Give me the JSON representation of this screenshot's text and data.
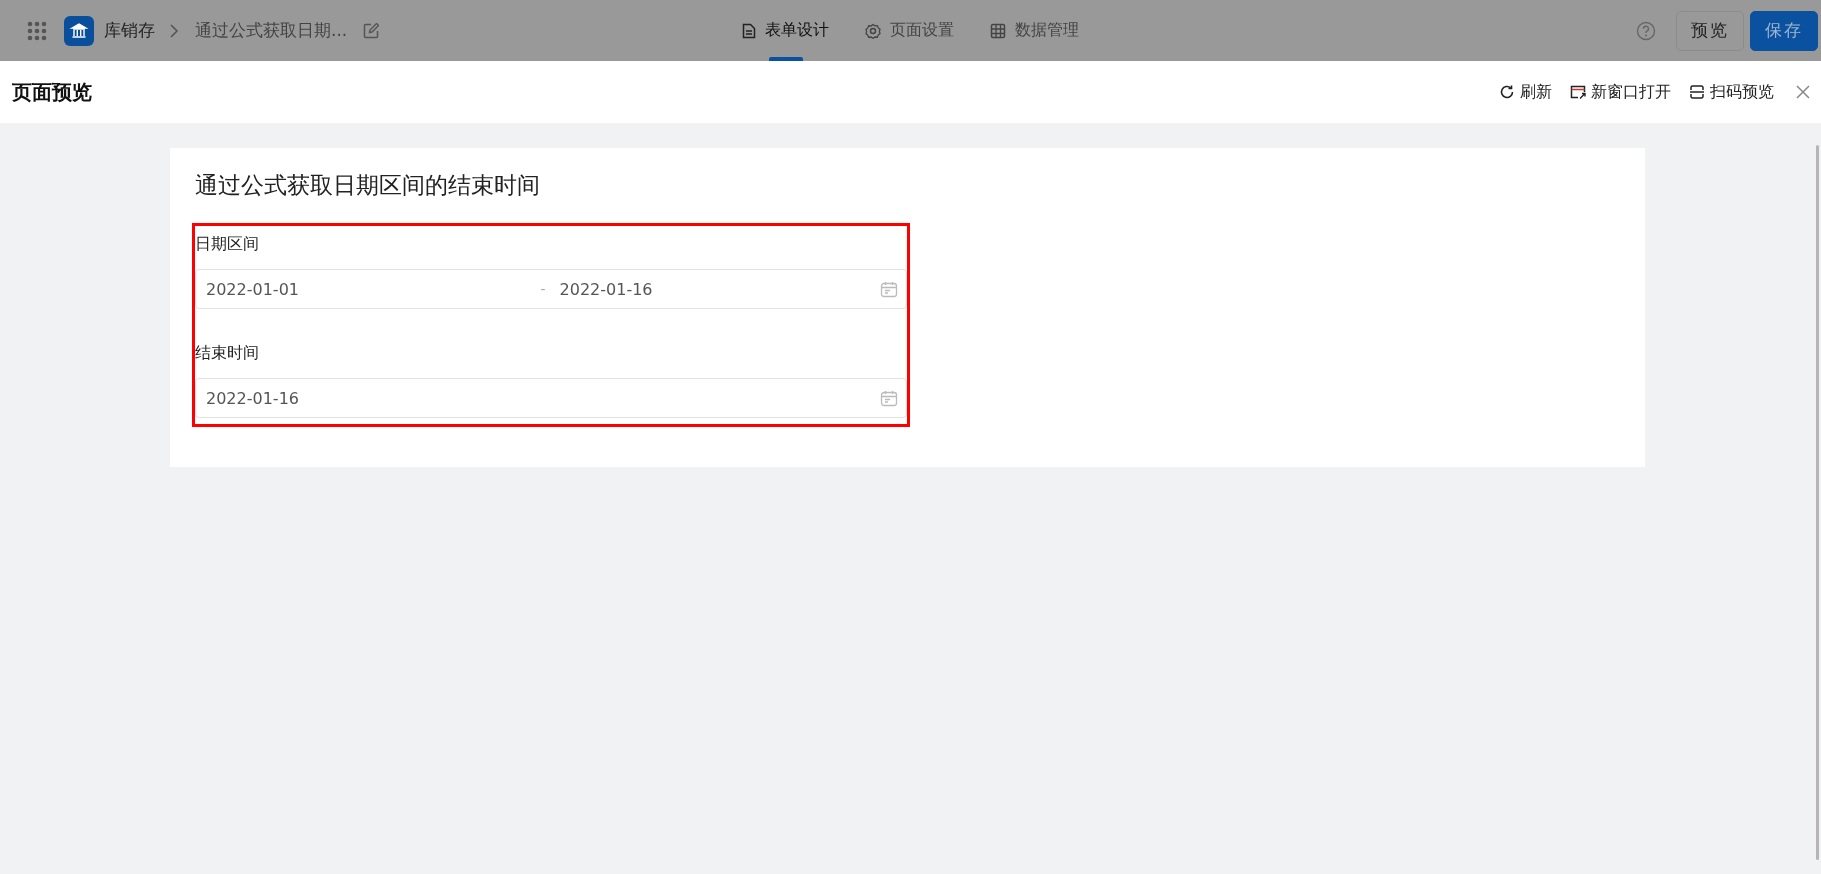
{
  "top_bar": {
    "app_name": "库销存",
    "page_title": "通过公式获取日期...",
    "tabs": [
      {
        "label": "表单设计",
        "selected": true
      },
      {
        "label": "页面设置",
        "selected": false
      },
      {
        "label": "数据管理",
        "selected": false
      }
    ],
    "buttons": [
      {
        "label": "预览",
        "kind": "default"
      },
      {
        "label": "保存",
        "kind": "primary"
      }
    ]
  },
  "preview": {
    "title": "页面预览",
    "actions": [
      {
        "label": "刷新"
      },
      {
        "label": "新窗口打开"
      },
      {
        "label": "扫码预览"
      }
    ],
    "form": {
      "title": "通过公式获取日期区间的结束时间",
      "highlighted": true,
      "fields": [
        {
          "kind": "range",
          "label": "日期区间",
          "start": "2022-01-01",
          "separator": "-",
          "end": "2022-01-16"
        },
        {
          "kind": "date",
          "label": "结束时间",
          "value": "2022-01-16"
        }
      ]
    }
  }
}
